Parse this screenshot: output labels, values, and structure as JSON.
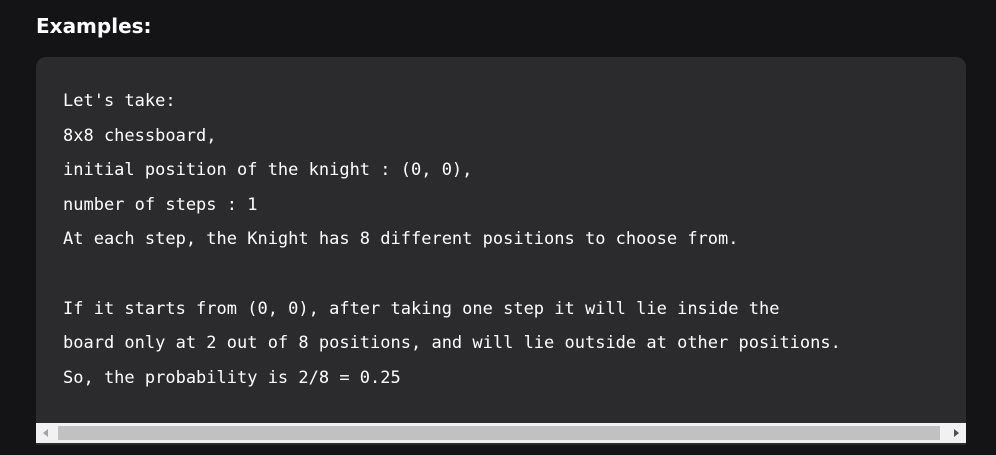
{
  "section": {
    "heading": "Examples:"
  },
  "code": {
    "lines": [
      "Let's take:",
      "8x8 chessboard,",
      "initial position of the knight : (0, 0),",
      "number of steps : 1",
      "At each step, the Knight has 8 different positions to choose from.",
      "",
      "If it starts from (0, 0), after taking one step it will lie inside the",
      "board only at 2 out of 8 positions, and will lie outside at other positions.",
      "So, the probability is 2/8 = 0.25"
    ]
  },
  "scrollbar": {
    "left_icon": "scroll-left-arrow-icon",
    "right_icon": "scroll-right-arrow-icon",
    "position_fraction": 0.0
  },
  "colors": {
    "page_background": "#141416",
    "code_background": "#2b2b2d",
    "text": "#ffffff",
    "scrollbar_track": "#f1f1f1",
    "scrollbar_thumb": "#c1c1c1"
  }
}
